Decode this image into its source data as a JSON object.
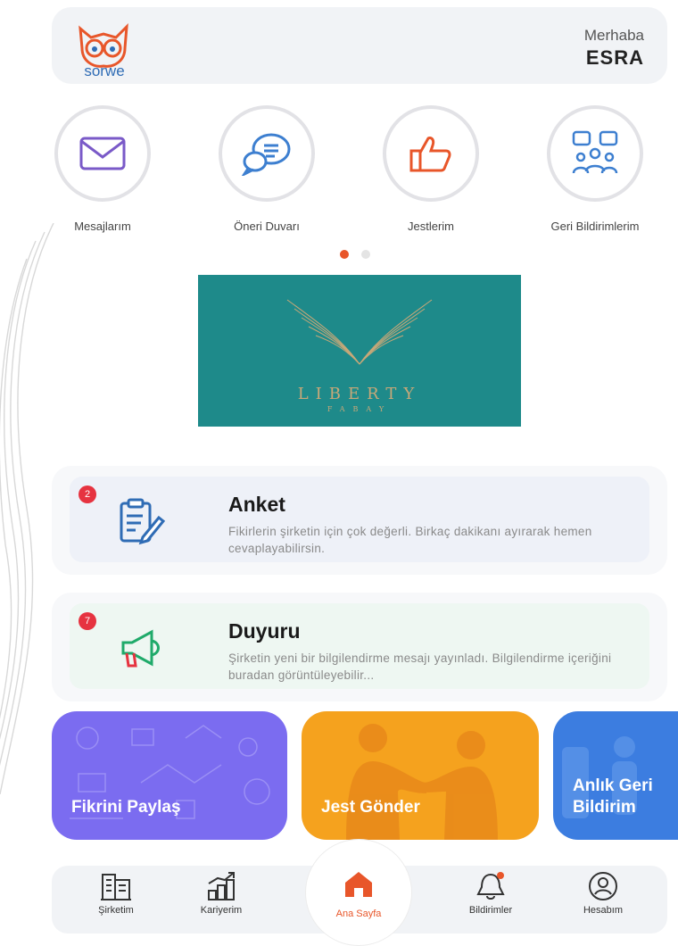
{
  "header": {
    "logo_text": "sorwe",
    "greeting": "Merhaba",
    "user_name": "ESRA"
  },
  "quick_actions": [
    {
      "label": "Mesajlarım",
      "icon": "envelope-icon"
    },
    {
      "label": "Öneri Duvarı",
      "icon": "chat-bubbles-icon"
    },
    {
      "label": "Jestlerim",
      "icon": "thumbs-up-icon"
    },
    {
      "label": "Geri Bildirimlerim",
      "icon": "feedback-group-icon"
    }
  ],
  "carousel": {
    "pages": 2,
    "active": 1
  },
  "banner": {
    "title": "LIBERTY",
    "subtitle": "FABAY",
    "bg_color": "#1e8a8a"
  },
  "cards": [
    {
      "badge": "2",
      "title": "Anket",
      "description": "Fikirlerin şirketin için çok değerli. Birkaç dakikanı ayırarak hemen cevaplayabilirsin.",
      "icon": "survey-clipboard-icon"
    },
    {
      "badge": "7",
      "title": "Duyuru",
      "description": "Şirketin yeni bir bilgilendirme mesajı yayınladı. Bilgilendirme içeriğini buradan görüntüleyebilir...",
      "icon": "megaphone-icon"
    }
  ],
  "tiles": [
    {
      "label": "Fikrini Paylaş",
      "color": "#7b6cf0"
    },
    {
      "label": "Jest Gönder",
      "color": "#f5a21e"
    },
    {
      "label": "Anlık Geri Bildirim",
      "color": "#3c7de0"
    }
  ],
  "bottom_nav": [
    {
      "label": "Şirketim",
      "icon": "building-icon"
    },
    {
      "label": "Kariyerim",
      "icon": "career-chart-icon"
    },
    {
      "label": "Ana Sayfa",
      "icon": "home-icon"
    },
    {
      "label": "Bildirimler",
      "icon": "bell-icon"
    },
    {
      "label": "Hesabım",
      "icon": "user-icon"
    }
  ],
  "colors": {
    "accent": "#e8562a",
    "primary": "#2f6cb5"
  }
}
